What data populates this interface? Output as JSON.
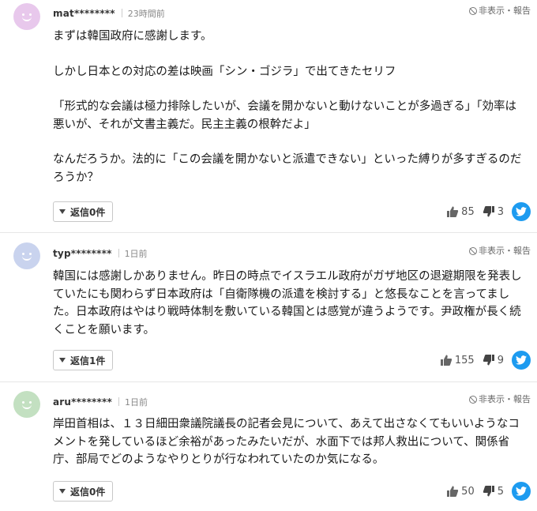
{
  "ui": {
    "hide_report": "非表示・報告"
  },
  "comments": [
    {
      "user": "mat********",
      "time": "23時間前",
      "avatar_color": "#e8c8ec",
      "paragraphs": [
        "まずは韓国政府に感謝します。",
        "しかし日本との対応の差は映画「シン・ゴジラ」で出てきたセリフ",
        "「形式的な会議は極力排除したいが、会議を開かないと動けないことが多過ぎる」「効率は悪いが、それが文書主義だ。民主主義の根幹だよ」",
        "なんだろうか。法的に「この会議を開かないと派遣できない」といった縛りが多すぎるのだろうか？"
      ],
      "reply": "返信0件",
      "likes": "85",
      "dislikes": "3"
    },
    {
      "user": "typ********",
      "time": "1日前",
      "avatar_color": "#c9d3ee",
      "paragraphs": [
        "韓国には感謝しかありません。昨日の時点でイスラエル政府がガザ地区の退避期限を発表していたにも関わらず日本政府は「自衛隊機の派遣を検討する」と悠長なことを言ってました。日本政府はやはり戦時体制を敷いている韓国とは感覚が違うようです。尹政権が長く続くことを願います。"
      ],
      "reply": "返信1件",
      "likes": "155",
      "dislikes": "9"
    },
    {
      "user": "aru********",
      "time": "1日前",
      "avatar_color": "#c3e0c1",
      "paragraphs": [
        "岸田首相は、１３日細田衆議院議長の記者会見について、あえて出さなくてもいいようなコメントを発しているほど余裕があったみたいだが、水面下では邦人救出について、関係省庁、部局でどのようなやりとりが行なわれていたのか気になる。"
      ],
      "reply": "返信0件",
      "likes": "50",
      "dislikes": "5"
    }
  ]
}
